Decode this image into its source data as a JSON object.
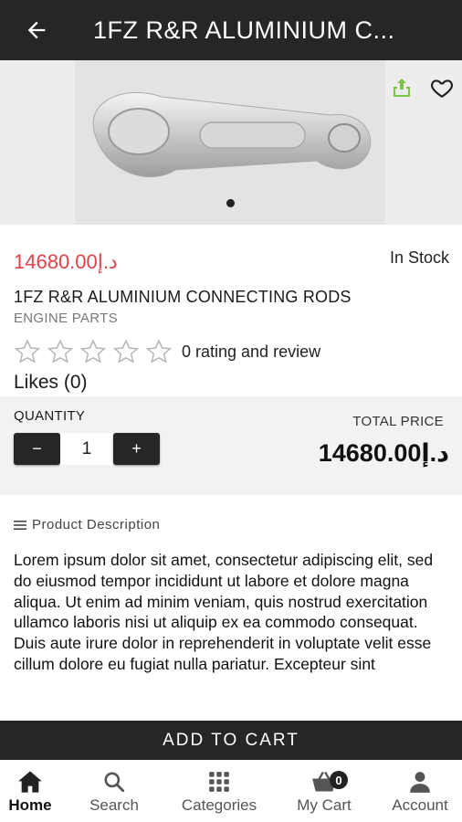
{
  "header": {
    "title": "1FZ R&R ALUMINIUM C..."
  },
  "hero": {
    "pager_count": 1,
    "pager_active": 1
  },
  "product": {
    "price": "14680.00د.إ",
    "stock": "In Stock",
    "name": "1FZ R&R ALUMINIUM CONNECTING RODS",
    "category": "ENGINE PARTS",
    "rating_text": "0 rating and review",
    "rating_value": 0,
    "rating_max": 5,
    "likes": "Likes (0)"
  },
  "quantity": {
    "label": "QUANTITY",
    "minus": "−",
    "value": "1",
    "plus": "+",
    "total_label": "TOTAL PRICE",
    "total_value": "14680.00د.إ"
  },
  "description": {
    "heading": "Product Description",
    "body": "Lorem ipsum dolor sit amet, consectetur adipiscing elit, sed do eiusmod tempor incididunt ut labore et dolore magna aliqua. Ut enim ad minim veniam, quis nostrud exercitation ullamco laboris nisi ut aliquip ex ea commodo consequat. Duis aute irure dolor in reprehenderit in voluptate velit esse cillum dolore eu fugiat nulla pariatur. Excepteur sint"
  },
  "cart_button": {
    "label": "ADD TO CART"
  },
  "bottom_nav": {
    "items": [
      {
        "label": "Home",
        "icon": "home-icon",
        "active": true
      },
      {
        "label": "Search",
        "icon": "search-icon",
        "active": false
      },
      {
        "label": "Categories",
        "icon": "grid-icon",
        "active": false
      },
      {
        "label": "My Cart",
        "icon": "basket-icon",
        "active": false,
        "badge": "0"
      },
      {
        "label": "Account",
        "icon": "person-icon",
        "active": false
      }
    ]
  },
  "colors": {
    "bar": "#262626",
    "price": "#e0424a",
    "share": "#7cc34a",
    "panel": "#f1f2f4"
  }
}
